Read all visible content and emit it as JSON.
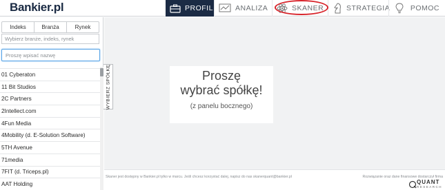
{
  "header": {
    "logo": "Bankier.pl",
    "nav": [
      {
        "label": "PROFIL",
        "icon": "briefcase-icon",
        "active": true
      },
      {
        "label": "ANALIZA",
        "icon": "chart-icon",
        "active": false
      },
      {
        "label": "SKANER",
        "icon": "atom-icon",
        "active": false
      },
      {
        "label": "STRATEGIA",
        "icon": "chess-knight-icon",
        "active": false
      },
      {
        "label": "POMOC",
        "icon": "lightbulb-icon",
        "active": false
      }
    ],
    "highlight_color": "#d8232a",
    "active_color": "#1b2b44"
  },
  "sidebar": {
    "tabs": [
      "Indeks",
      "Branża",
      "Rynek"
    ],
    "filter_placeholder": "Wybierz branże, indeks, rynek",
    "search_placeholder": "Proszę wpisać nazwę",
    "items": [
      "01 Cyberaton",
      "11 Bit Studios",
      "2C Partners",
      "2Intellect.com",
      "4Fun Media",
      "4Mobility (d. E-Solution Software)",
      "5TH Avenue",
      "71media",
      "7FIT (d. Triceps.pl)",
      "AAT Holding"
    ],
    "vertical_tab": "WYBIERZ SPÓŁKĘ"
  },
  "main": {
    "title_line1": "Proszę",
    "title_line2": "wybrać spółkę!",
    "subtitle": "(z panelu bocznego)"
  },
  "footer": {
    "left": "Skaner jest dostępny w Bankier.pl tylko w marcu. Jeśli chcesz korzystać dalej, napisz do nas skanerquant@bankier.pl",
    "right": "Rozwiązanie oraz dane finansowe dostarczył firma",
    "brand": "QUANT",
    "brand_sub": "RESEARCH"
  }
}
